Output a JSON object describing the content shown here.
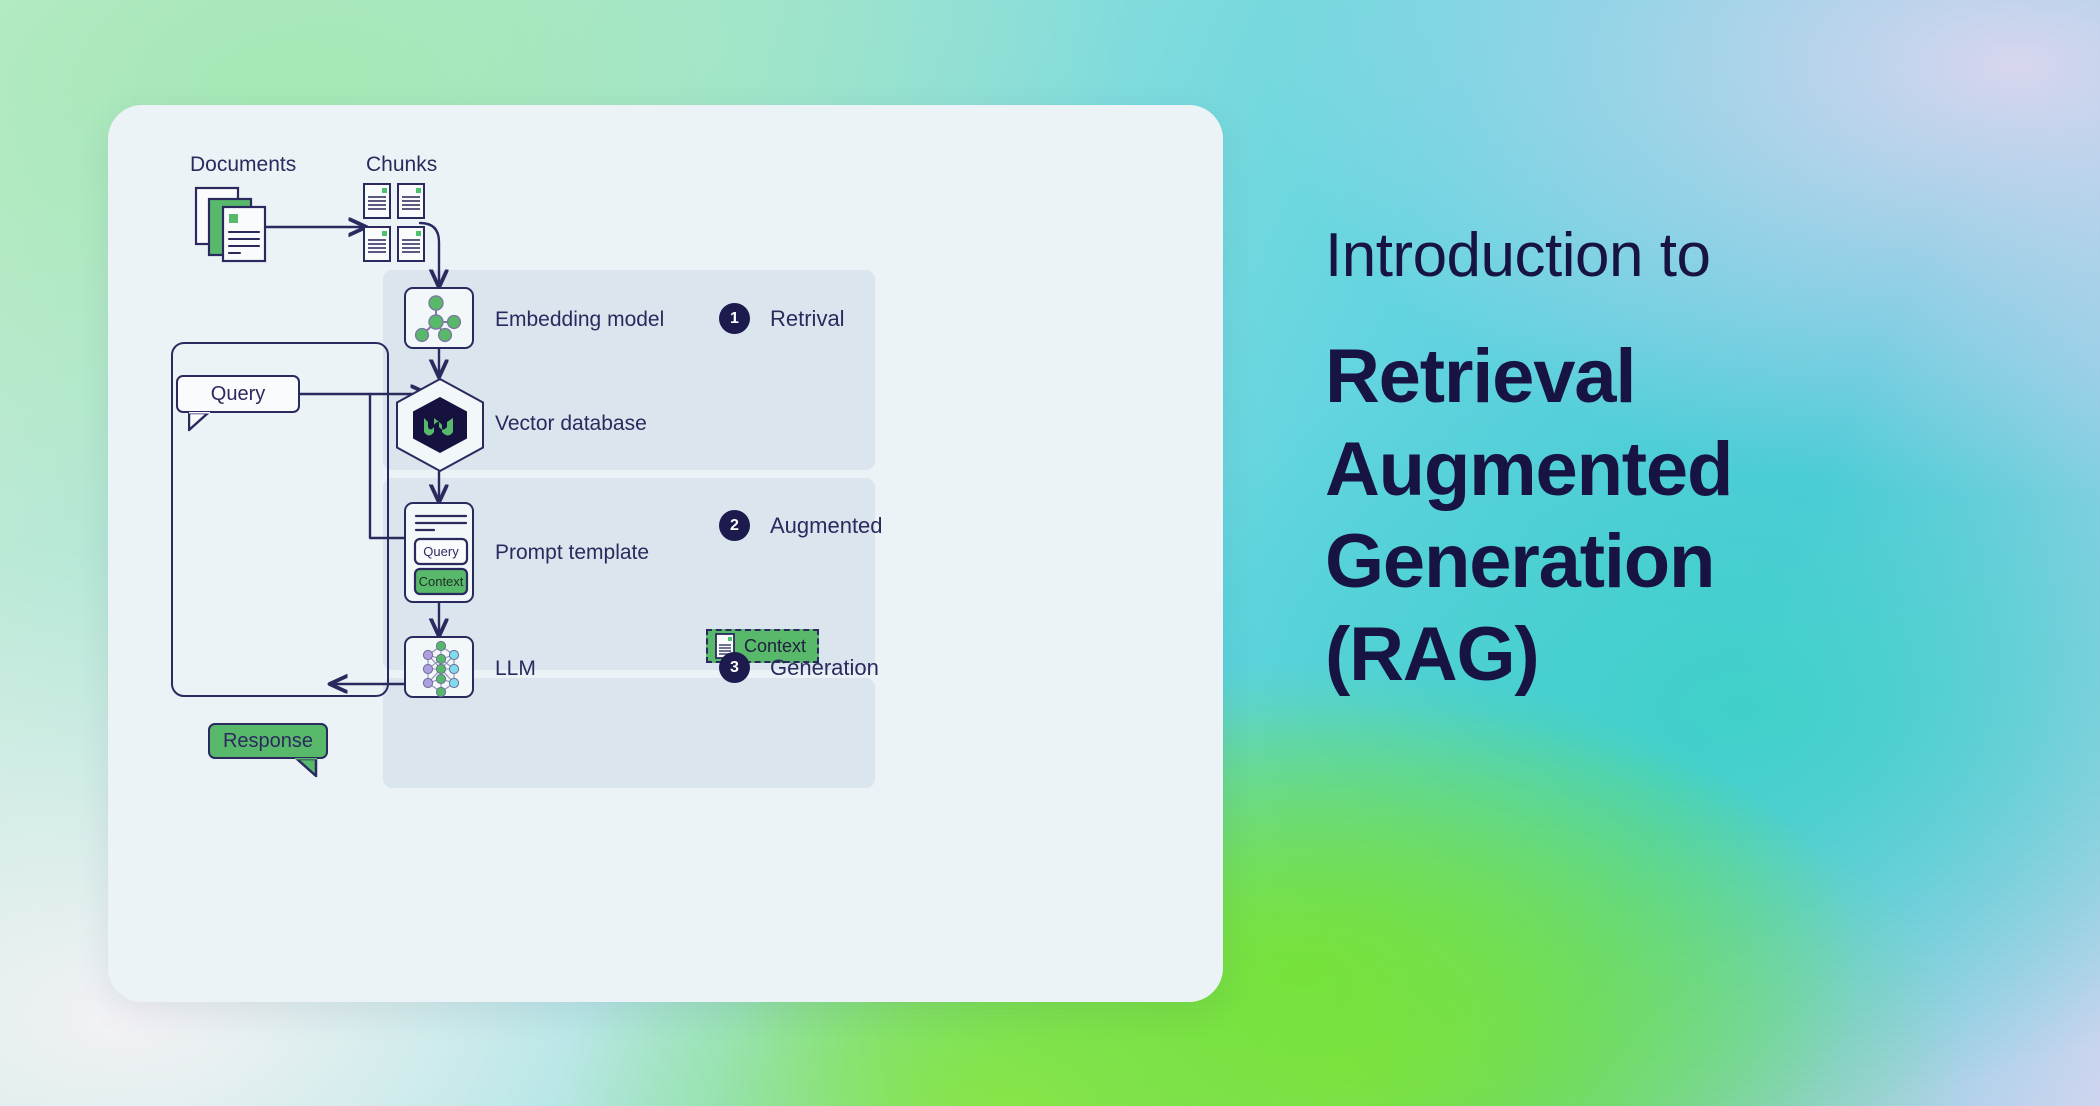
{
  "page": {
    "background_gradient_colors": [
      "#a4e8b4",
      "#62d4e0",
      "#7ee03f",
      "#d7d5ef",
      "#f3f2f6"
    ],
    "card_background": "#ecf3f6"
  },
  "title": {
    "kicker": "Introduction to",
    "lines": [
      "Retrieval",
      "Augmented",
      "Generation",
      "(RAG)"
    ],
    "color": "#171444"
  },
  "diagram": {
    "title": "Retrieval Augmented Generation (RAG) pipeline",
    "accent_green": "#59b96b",
    "ink": "#2b2a5e",
    "band_fill": "#dbe5ee",
    "sources": {
      "documents_label": "Documents",
      "chunks_label": "Chunks",
      "chunk_count": 4
    },
    "loop": {
      "query_label": "Query",
      "response_label": "Response"
    },
    "nodes": [
      {
        "id": "embedding-model",
        "label": "Embedding model",
        "icon": "node-graph-icon"
      },
      {
        "id": "vector-database",
        "label": "Vector database",
        "icon": "hexagon-database-icon"
      },
      {
        "id": "prompt-template",
        "label": "Prompt template",
        "icon": "document-template-icon"
      },
      {
        "id": "llm",
        "label": "LLM",
        "icon": "neural-network-icon"
      }
    ],
    "prompt_template": {
      "query_slot": "Query",
      "context_slot": "Context"
    },
    "context_chip": {
      "label": "Context",
      "icon": "document-icon"
    },
    "steps": [
      {
        "number": "1",
        "label": "Retrival"
      },
      {
        "number": "2",
        "label": "Augmented"
      },
      {
        "number": "3",
        "label": "Generation"
      }
    ]
  }
}
